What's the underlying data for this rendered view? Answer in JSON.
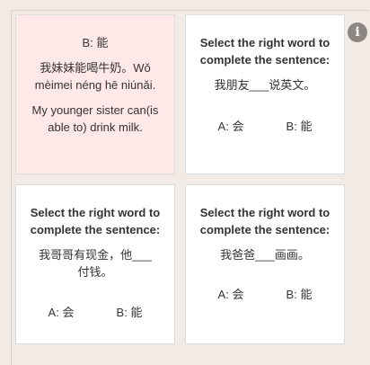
{
  "cards": [
    {
      "answer": "B: 能",
      "sentence": "我妹妹能喝牛奶。Wǒ mèimei néng hē niúnǎi.",
      "translation": "My younger sister can(is able to) drink milk."
    },
    {
      "question": "Select the right word to complete the sentence:",
      "sentence": "我朋友___说英文。",
      "option_a": "A: 会",
      "option_b": "B: 能"
    },
    {
      "question": "Select the right word to complete the sentence:",
      "sentence": "我哥哥有现金，他___付钱。",
      "option_a": "A: 会",
      "option_b": "B: 能"
    },
    {
      "question": "Select the right word to complete the sentence:",
      "sentence": "我爸爸___画画。",
      "option_a": "A: 会",
      "option_b": "B: 能"
    }
  ],
  "info_icon": "i"
}
